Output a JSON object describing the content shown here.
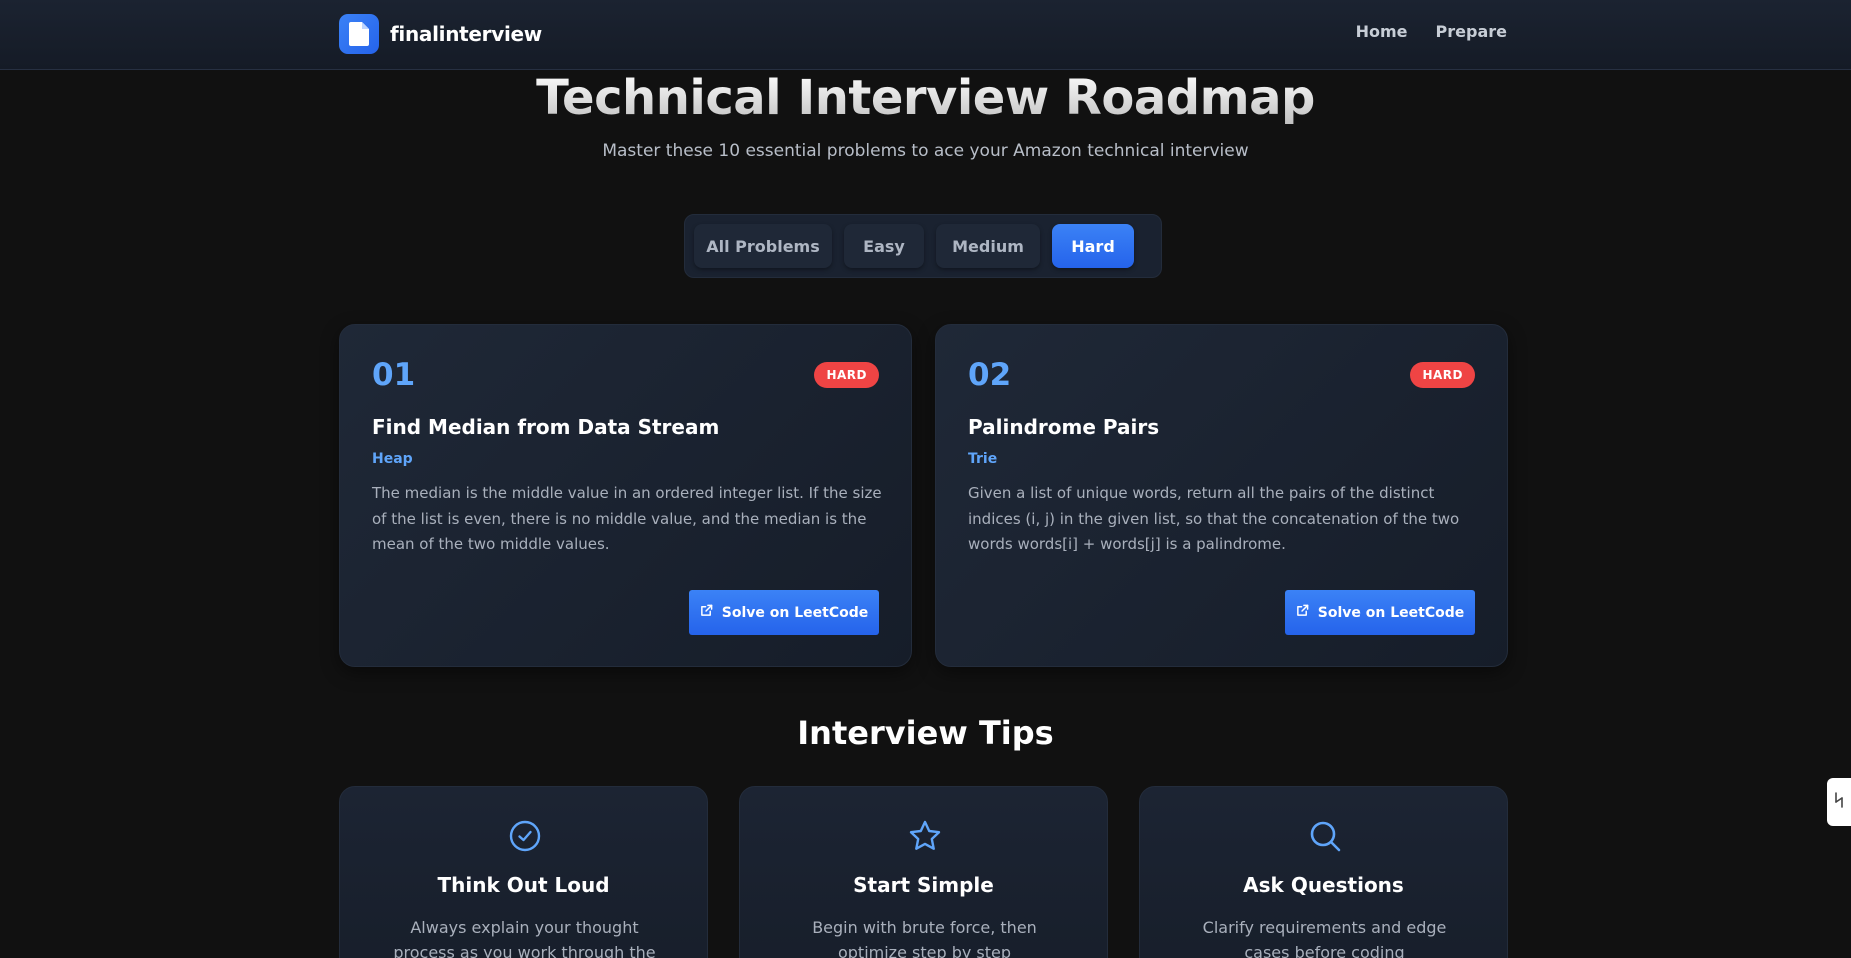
{
  "header": {
    "brand": "finalinterview",
    "nav": [
      "Home",
      "Prepare"
    ]
  },
  "hero": {
    "title": "Technical Interview Roadmap",
    "subtitle": "Master these 10 essential problems to ace your Amazon technical interview"
  },
  "filters": {
    "items": [
      "All Problems",
      "Easy",
      "Medium",
      "Hard"
    ],
    "selected": "Hard"
  },
  "problems": [
    {
      "number": "01",
      "difficulty": "HARD",
      "title": "Find Median from Data Stream",
      "category": "Heap",
      "description": "The median is the middle value in an ordered integer list. If the size of the list is even, there is no middle value, and the median is the mean of the two middle values.",
      "button": "Solve on LeetCode"
    },
    {
      "number": "02",
      "difficulty": "HARD",
      "title": "Palindrome Pairs",
      "category": "Trie",
      "description": "Given a list of unique words, return all the pairs of the distinct indices (i, j) in the given list, so that the concatenation of the two words words[i] + words[j] is a palindrome.",
      "button": "Solve on LeetCode"
    }
  ],
  "tips": {
    "heading": "Interview Tips",
    "items": [
      {
        "icon": "check-circle-icon",
        "title": "Think Out Loud",
        "text": "Always explain your thought process as you work through the problem"
      },
      {
        "icon": "star-icon",
        "title": "Start Simple",
        "text": "Begin with brute force, then optimize step by step"
      },
      {
        "icon": "search-icon",
        "title": "Ask Questions",
        "text": "Clarify requirements and edge cases before coding"
      }
    ]
  },
  "colors": {
    "accent": "#3b82f6",
    "accent_text": "#5fa5fa",
    "hard_badge": "#ef4444",
    "background": "#111111",
    "card": "#1f2837"
  }
}
